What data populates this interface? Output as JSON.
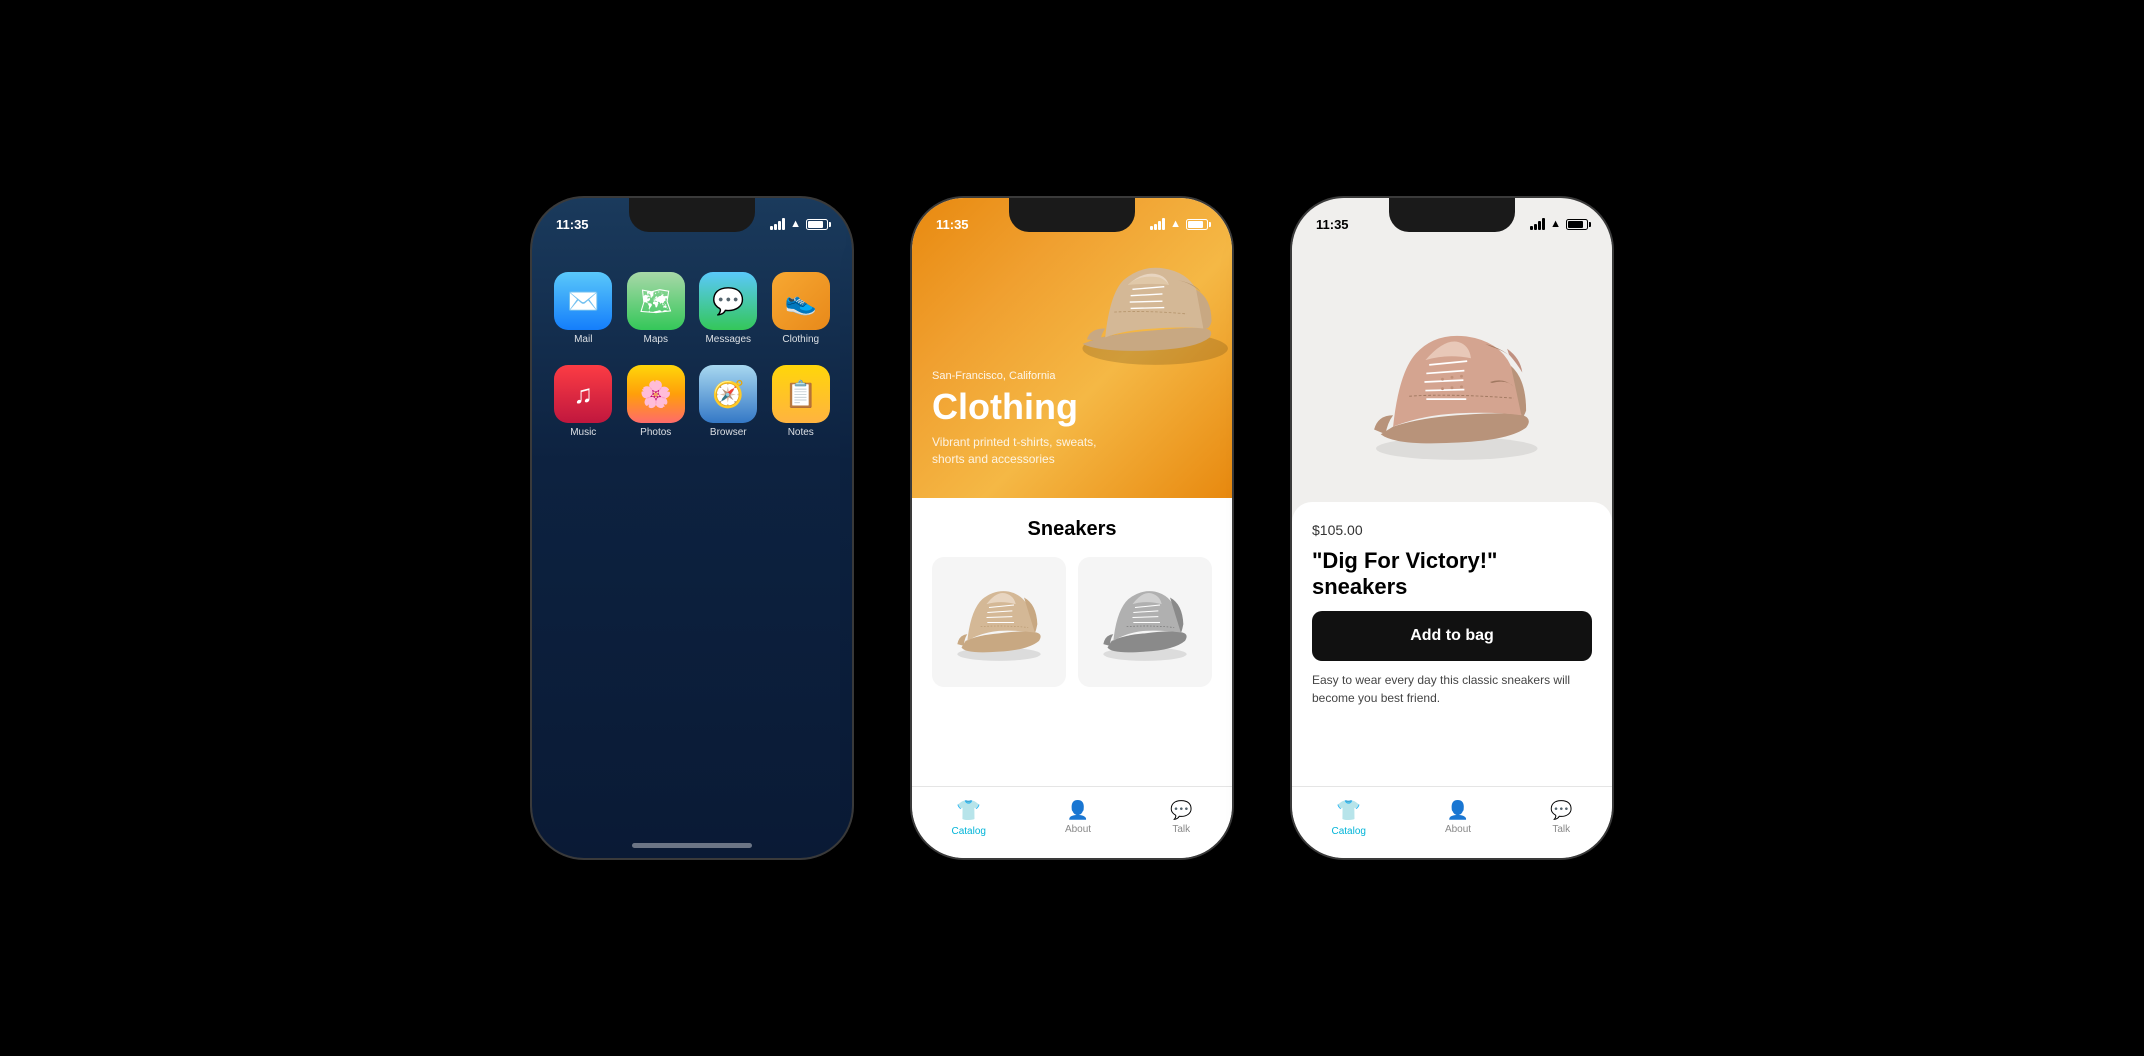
{
  "phones": {
    "phone1": {
      "status": {
        "time": "11:35"
      },
      "apps": [
        {
          "id": "mail",
          "label": "Mail",
          "icon": "✉️",
          "class": "icon-mail"
        },
        {
          "id": "maps",
          "label": "Maps",
          "icon": "🗺️",
          "class": "icon-maps"
        },
        {
          "id": "messages",
          "label": "Messages",
          "icon": "💬",
          "class": "icon-messages"
        },
        {
          "id": "clothing",
          "label": "Clothing",
          "icon": "👟",
          "class": "icon-clothing"
        },
        {
          "id": "music",
          "label": "Music",
          "icon": "🎵",
          "class": "icon-music"
        },
        {
          "id": "photos",
          "label": "Photos",
          "icon": "🌸",
          "class": "icon-photos"
        },
        {
          "id": "browser",
          "label": "Browser",
          "icon": "🧭",
          "class": "icon-browser"
        },
        {
          "id": "notes",
          "label": "Notes",
          "icon": "📝",
          "class": "icon-notes"
        }
      ]
    },
    "phone2": {
      "status": {
        "time": "11:35"
      },
      "hero": {
        "location": "San-Francisco, California",
        "title": "Clothing",
        "subtitle": "Vibrant printed t-shirts, sweats, shorts and accessories"
      },
      "section_title": "Sneakers",
      "tabs": [
        {
          "id": "catalog",
          "label": "Catalog",
          "active": true
        },
        {
          "id": "about",
          "label": "About",
          "active": false
        },
        {
          "id": "talk",
          "label": "Talk",
          "active": false
        }
      ]
    },
    "phone3": {
      "status": {
        "time": "11:35"
      },
      "product": {
        "price": "$105.00",
        "name": "\"Dig For Victory!\" sneakers",
        "add_to_bag": "Add to bag",
        "description": "Easy to wear every day this classic sneakers will become you best friend."
      },
      "tabs": [
        {
          "id": "catalog",
          "label": "Catalog",
          "active": true
        },
        {
          "id": "about",
          "label": "About",
          "active": false
        },
        {
          "id": "talk",
          "label": "Talk",
          "active": false
        }
      ]
    }
  }
}
